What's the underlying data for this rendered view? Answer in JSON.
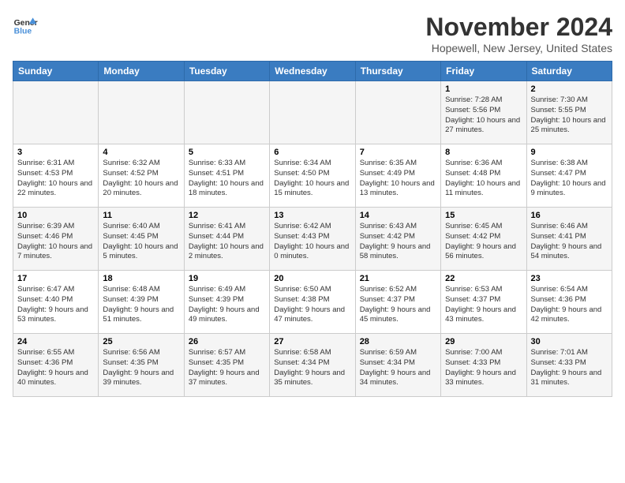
{
  "header": {
    "logo_line1": "General",
    "logo_line2": "Blue",
    "month": "November 2024",
    "location": "Hopewell, New Jersey, United States"
  },
  "weekdays": [
    "Sunday",
    "Monday",
    "Tuesday",
    "Wednesday",
    "Thursday",
    "Friday",
    "Saturday"
  ],
  "weeks": [
    [
      {
        "day": "",
        "info": ""
      },
      {
        "day": "",
        "info": ""
      },
      {
        "day": "",
        "info": ""
      },
      {
        "day": "",
        "info": ""
      },
      {
        "day": "",
        "info": ""
      },
      {
        "day": "1",
        "info": "Sunrise: 7:28 AM\nSunset: 5:56 PM\nDaylight: 10 hours and 27 minutes."
      },
      {
        "day": "2",
        "info": "Sunrise: 7:30 AM\nSunset: 5:55 PM\nDaylight: 10 hours and 25 minutes."
      }
    ],
    [
      {
        "day": "3",
        "info": "Sunrise: 6:31 AM\nSunset: 4:53 PM\nDaylight: 10 hours and 22 minutes."
      },
      {
        "day": "4",
        "info": "Sunrise: 6:32 AM\nSunset: 4:52 PM\nDaylight: 10 hours and 20 minutes."
      },
      {
        "day": "5",
        "info": "Sunrise: 6:33 AM\nSunset: 4:51 PM\nDaylight: 10 hours and 18 minutes."
      },
      {
        "day": "6",
        "info": "Sunrise: 6:34 AM\nSunset: 4:50 PM\nDaylight: 10 hours and 15 minutes."
      },
      {
        "day": "7",
        "info": "Sunrise: 6:35 AM\nSunset: 4:49 PM\nDaylight: 10 hours and 13 minutes."
      },
      {
        "day": "8",
        "info": "Sunrise: 6:36 AM\nSunset: 4:48 PM\nDaylight: 10 hours and 11 minutes."
      },
      {
        "day": "9",
        "info": "Sunrise: 6:38 AM\nSunset: 4:47 PM\nDaylight: 10 hours and 9 minutes."
      }
    ],
    [
      {
        "day": "10",
        "info": "Sunrise: 6:39 AM\nSunset: 4:46 PM\nDaylight: 10 hours and 7 minutes."
      },
      {
        "day": "11",
        "info": "Sunrise: 6:40 AM\nSunset: 4:45 PM\nDaylight: 10 hours and 5 minutes."
      },
      {
        "day": "12",
        "info": "Sunrise: 6:41 AM\nSunset: 4:44 PM\nDaylight: 10 hours and 2 minutes."
      },
      {
        "day": "13",
        "info": "Sunrise: 6:42 AM\nSunset: 4:43 PM\nDaylight: 10 hours and 0 minutes."
      },
      {
        "day": "14",
        "info": "Sunrise: 6:43 AM\nSunset: 4:42 PM\nDaylight: 9 hours and 58 minutes."
      },
      {
        "day": "15",
        "info": "Sunrise: 6:45 AM\nSunset: 4:42 PM\nDaylight: 9 hours and 56 minutes."
      },
      {
        "day": "16",
        "info": "Sunrise: 6:46 AM\nSunset: 4:41 PM\nDaylight: 9 hours and 54 minutes."
      }
    ],
    [
      {
        "day": "17",
        "info": "Sunrise: 6:47 AM\nSunset: 4:40 PM\nDaylight: 9 hours and 53 minutes."
      },
      {
        "day": "18",
        "info": "Sunrise: 6:48 AM\nSunset: 4:39 PM\nDaylight: 9 hours and 51 minutes."
      },
      {
        "day": "19",
        "info": "Sunrise: 6:49 AM\nSunset: 4:39 PM\nDaylight: 9 hours and 49 minutes."
      },
      {
        "day": "20",
        "info": "Sunrise: 6:50 AM\nSunset: 4:38 PM\nDaylight: 9 hours and 47 minutes."
      },
      {
        "day": "21",
        "info": "Sunrise: 6:52 AM\nSunset: 4:37 PM\nDaylight: 9 hours and 45 minutes."
      },
      {
        "day": "22",
        "info": "Sunrise: 6:53 AM\nSunset: 4:37 PM\nDaylight: 9 hours and 43 minutes."
      },
      {
        "day": "23",
        "info": "Sunrise: 6:54 AM\nSunset: 4:36 PM\nDaylight: 9 hours and 42 minutes."
      }
    ],
    [
      {
        "day": "24",
        "info": "Sunrise: 6:55 AM\nSunset: 4:36 PM\nDaylight: 9 hours and 40 minutes."
      },
      {
        "day": "25",
        "info": "Sunrise: 6:56 AM\nSunset: 4:35 PM\nDaylight: 9 hours and 39 minutes."
      },
      {
        "day": "26",
        "info": "Sunrise: 6:57 AM\nSunset: 4:35 PM\nDaylight: 9 hours and 37 minutes."
      },
      {
        "day": "27",
        "info": "Sunrise: 6:58 AM\nSunset: 4:34 PM\nDaylight: 9 hours and 35 minutes."
      },
      {
        "day": "28",
        "info": "Sunrise: 6:59 AM\nSunset: 4:34 PM\nDaylight: 9 hours and 34 minutes."
      },
      {
        "day": "29",
        "info": "Sunrise: 7:00 AM\nSunset: 4:33 PM\nDaylight: 9 hours and 33 minutes."
      },
      {
        "day": "30",
        "info": "Sunrise: 7:01 AM\nSunset: 4:33 PM\nDaylight: 9 hours and 31 minutes."
      }
    ]
  ]
}
